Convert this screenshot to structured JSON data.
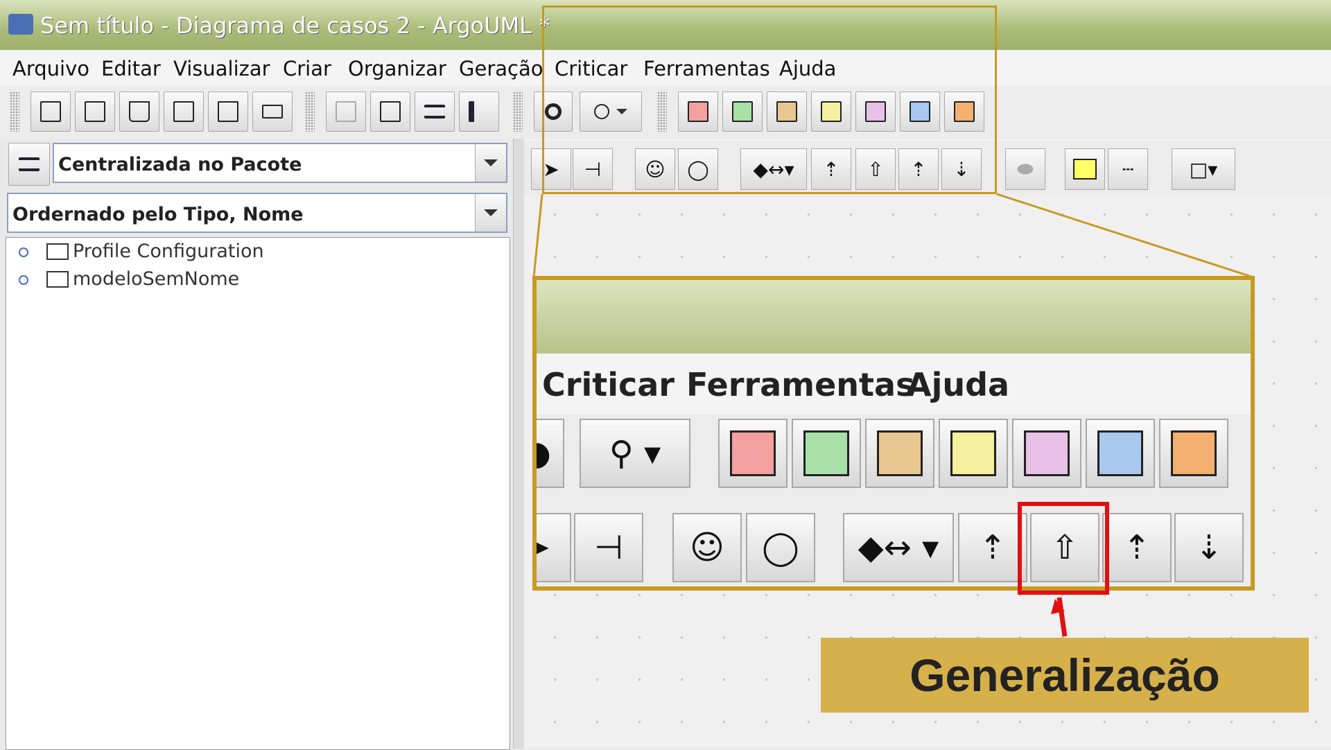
{
  "window": {
    "title": "Sem título - Diagrama de casos 2 - ArgoUML *"
  },
  "menu": {
    "items": [
      "Arquivo",
      "Editar",
      "Visualizar",
      "Criar",
      "Organizar",
      "Geração",
      "Criticar",
      "Ferramentas",
      "Ajuda"
    ]
  },
  "toolbar": {
    "icons": [
      "new-diagram-icon",
      "new-project-icon",
      "open-icon",
      "save-icon",
      "export-icon",
      "print-icon",
      "delete-disabled-icon",
      "trash-icon",
      "navigate-icon",
      "settings-icon",
      "find-icon",
      "zoom-icon",
      "usecase-diagram-icon",
      "class-diagram-icon",
      "sequence-diagram-icon",
      "collaboration-diagram-icon",
      "state-diagram-icon",
      "activity-diagram-icon",
      "deployment-diagram-icon"
    ]
  },
  "navigator": {
    "perspective": "Centralizada no Pacote",
    "ordering": "Ordernado pelo Tipo, Nome",
    "tree": [
      "Profile Configuration",
      "modeloSemNome"
    ]
  },
  "diagram_toolbar": {
    "tools": [
      "select-icon",
      "broom-icon",
      "actor-icon",
      "usecase-icon",
      "association-icon",
      "dependency-icon",
      "generalization-icon",
      "extend-icon",
      "include-icon",
      "ellipse-icon",
      "note-icon",
      "dashed-line-icon",
      "rectangle-icon"
    ]
  },
  "zoom": {
    "menu": [
      "Criticar",
      "Ferramentas",
      "Ajuda"
    ]
  },
  "callout": {
    "label": "Generalização",
    "highlight_color": "#e01010",
    "callout_color": "#d6b04a",
    "frame_color": "#c89a20"
  }
}
